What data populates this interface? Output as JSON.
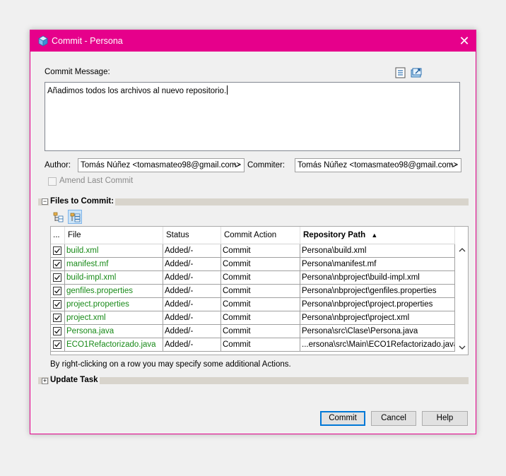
{
  "window": {
    "title": "Commit - Persona",
    "close_glyph": "✕"
  },
  "commit_message": {
    "label": "Commit Message:",
    "text": "Añadimos todos los archivos al nuevo repositorio."
  },
  "author": {
    "label": "Author:",
    "value": "Tomás Núñez <tomasmateo98@gmail.com>"
  },
  "committer": {
    "label": "Commiter:",
    "value": "Tomás Núñez <tomasmateo98@gmail.com>"
  },
  "amend": {
    "label": "Amend Last Commit"
  },
  "files_section": {
    "title": "Files to Commit:",
    "expander": "−"
  },
  "table": {
    "headers": {
      "select": "...",
      "file": "File",
      "status": "Status",
      "action": "Commit Action",
      "path": "Repository Path",
      "sort_glyph": "▲"
    },
    "rows": [
      {
        "file": "build.xml",
        "status": "Added/-",
        "action": "Commit",
        "path": "Persona\\build.xml"
      },
      {
        "file": "manifest.mf",
        "status": "Added/-",
        "action": "Commit",
        "path": "Persona\\manifest.mf"
      },
      {
        "file": "build-impl.xml",
        "status": "Added/-",
        "action": "Commit",
        "path": "Persona\\nbproject\\build-impl.xml"
      },
      {
        "file": "genfiles.properties",
        "status": "Added/-",
        "action": "Commit",
        "path": "Persona\\nbproject\\genfiles.properties"
      },
      {
        "file": "project.properties",
        "status": "Added/-",
        "action": "Commit",
        "path": "Persona\\nbproject\\project.properties"
      },
      {
        "file": "project.xml",
        "status": "Added/-",
        "action": "Commit",
        "path": "Persona\\nbproject\\project.xml"
      },
      {
        "file": "Persona.java",
        "status": "Added/-",
        "action": "Commit",
        "path": "Persona\\src\\Clase\\Persona.java"
      },
      {
        "file": "ECO1Refactorizado.java",
        "status": "Added/-",
        "action": "Commit",
        "path": "...ersona\\src\\Main\\ECO1Refactorizado.java"
      }
    ]
  },
  "hint": "By right-clicking on a row you may specify some additional Actions.",
  "update_section": {
    "title": "Update Task",
    "expander": "+"
  },
  "buttons": {
    "commit": "Commit",
    "cancel": "Cancel",
    "help": "Help"
  },
  "colors": {
    "titlebar": "#e6008b",
    "file_text": "#188a18",
    "default_button_border": "#0078d7"
  },
  "icons": [
    "netbeans-cube-icon",
    "close-icon",
    "recent-messages-icon",
    "load-template-icon",
    "tree-view-icon",
    "flat-view-icon",
    "sort-ascending-icon",
    "chevron-down-icon",
    "scroll-up-icon",
    "scroll-down-icon",
    "checkbox-checked-icon"
  ]
}
